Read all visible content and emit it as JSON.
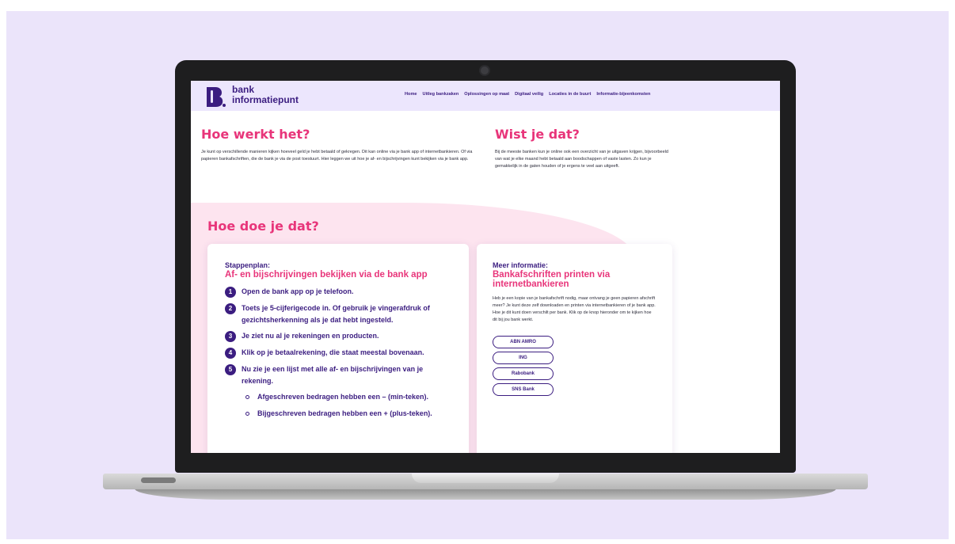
{
  "header": {
    "logo_letter": "B.",
    "logo_line1": "bank",
    "logo_line2": "informatiepunt",
    "nav": [
      "Home",
      "Uitleg bankzaken",
      "Oplossingen op maat",
      "Digitaal veilig",
      "Locaties in de buurt",
      "Informatie-bijeenkomsten"
    ]
  },
  "intro": {
    "title": "Hoe werkt het?",
    "text": "Je kunt op verschillende manieren kijken hoeveel geld je hebt betaald of gekregen. Dit kan online via je bank app of internetbankieren. Of via papieren bankafschriften, die de bank je via de post toestuurt. Hier leggen we uit hoe je af- en bijschrijvingen kunt bekijken via je bank app."
  },
  "tip": {
    "title": "Wist je dat?",
    "text": "Bij de meeste banken kun je online ook een overzicht van je uitgaven krijgen, bijvoorbeeld van wat je elke maand hebt betaald aan boodschappen of vaste lasten. Zo kun je gemakkelijk in de gaten houden of je ergens te veel aan uitgeeft."
  },
  "how": {
    "section_title": "Hoe doe je dat?",
    "label": "Stappenplan:",
    "title": "Af- en bijschrijvingen bekijken via de bank app",
    "steps": [
      {
        "num": "1",
        "text": "Open de bank app op je telefoon."
      },
      {
        "num": "2",
        "text": "Toets je 5-cijferigecode in. Of gebruik je vingerafdruk of gezichtsherkenning als je dat hebt ingesteld."
      },
      {
        "num": "3",
        "text": "Je ziet nu al je rekeningen en producten."
      },
      {
        "num": "4",
        "text": "Klik op je betaalrekening, die staat meestal bovenaan."
      },
      {
        "num": "5",
        "text": "Nu zie je een lijst met alle af- en bijschrijvingen van je rekening."
      }
    ],
    "sub_items": [
      "Afgeschreven bedragen hebben een – (min-teken).",
      "Bijgeschreven bedragen hebben een + (plus-teken)."
    ]
  },
  "more_info": {
    "label": "Meer informatie:",
    "title": "Bankafschriften printen via internetbankieren",
    "text": "Heb je een kopie van je bankafschrift nodig, maar ontvang je geen papieren afschrift meer? Je kunt deze zelf downloaden en printen via internetbankieren of je bank app. Hoe je dit kunt doen verschilt per bank. Klik op de knop hieronder om te kijken hoe dit bij jou bank werkt.",
    "buttons": [
      "ABN AMRO",
      "ING",
      "Rabobank",
      "SNS Bank"
    ]
  },
  "colors": {
    "brand_purple": "#3b1d80",
    "accent_pink": "#e8357a",
    "header_bg": "#ece6fd",
    "section_bg": "#fde4ef",
    "backdrop": "#ebe4fa"
  }
}
